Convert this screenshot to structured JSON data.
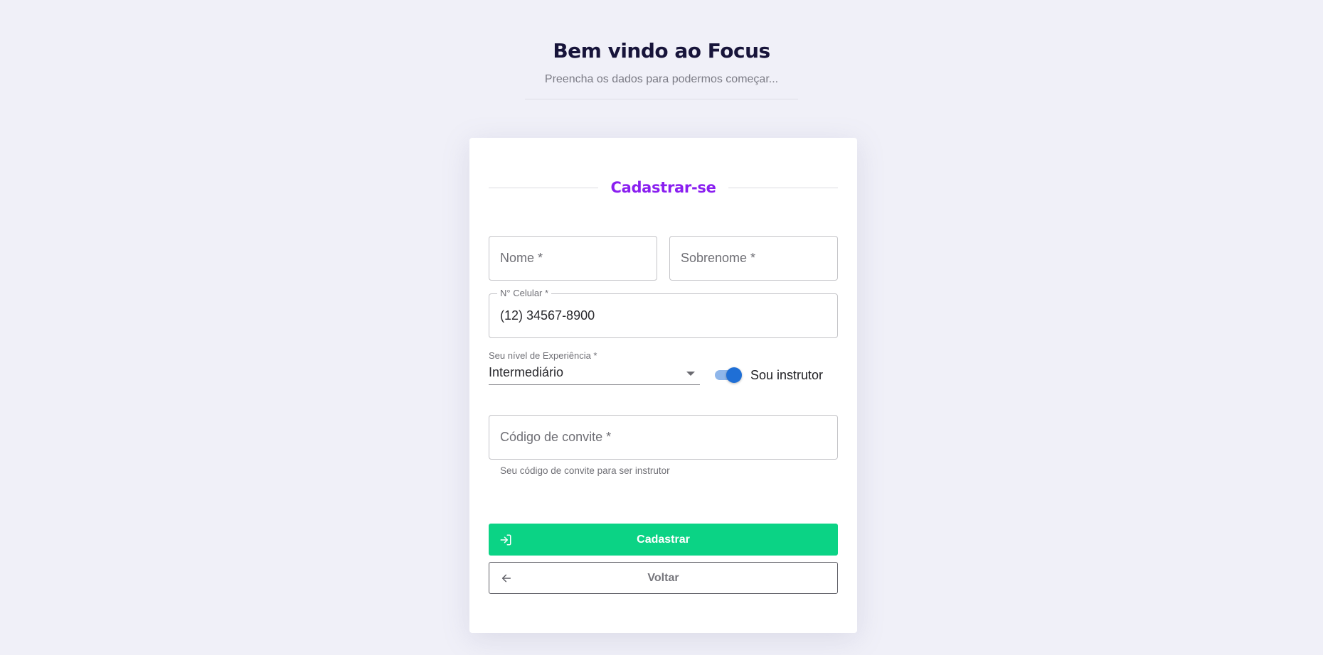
{
  "header": {
    "title": "Bem vindo ao Focus",
    "subtitle": "Preencha os dados para podermos começar..."
  },
  "form": {
    "section_title": "Cadastrar-se",
    "first_name": {
      "placeholder": "Nome *",
      "value": ""
    },
    "last_name": {
      "placeholder": "Sobrenome *",
      "value": ""
    },
    "phone": {
      "label": "N° Celular *",
      "value": "(12) 34567-8900"
    },
    "experience": {
      "label": "Seu nível de Experiência *",
      "selected": "Intermediário"
    },
    "instructor_toggle": {
      "label": "Sou instrutor",
      "checked": true
    },
    "invite_code": {
      "placeholder": "Código de convite *",
      "helper": "Seu código de convite para ser instrutor"
    },
    "submit_label": "Cadastrar",
    "back_label": "Voltar"
  },
  "colors": {
    "background": "#f0f0f8",
    "title": "#17143a",
    "accent": "#8a1ff0",
    "primary_button": "#0bd385",
    "toggle": "#1f6fd6"
  },
  "icons": {
    "submit": "login-icon",
    "back": "arrow-left-icon"
  }
}
